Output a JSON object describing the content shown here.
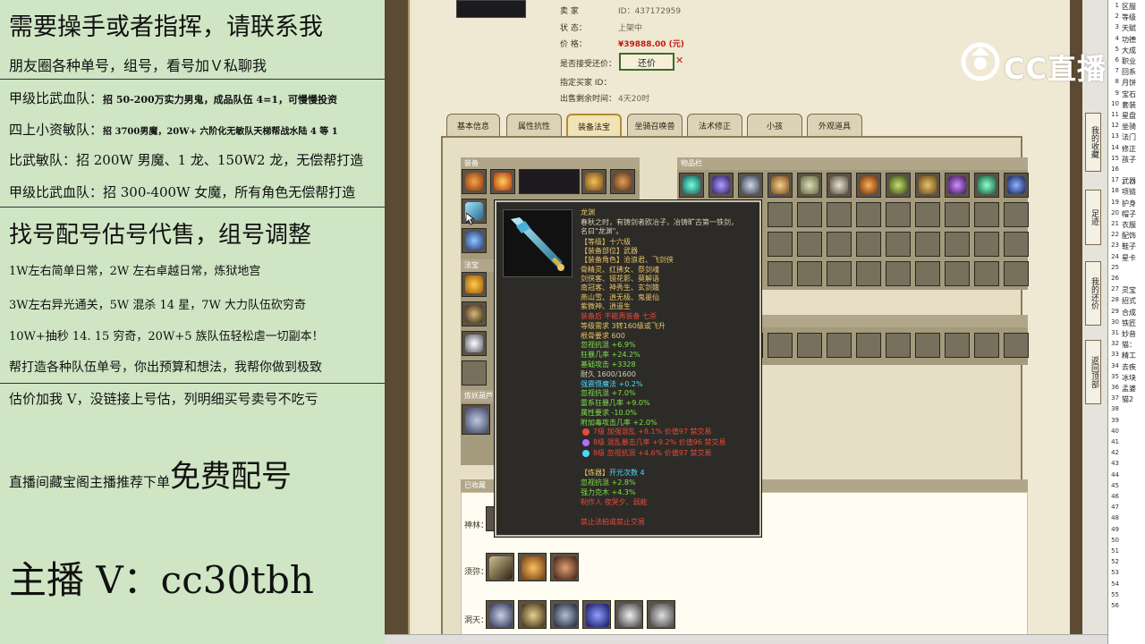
{
  "promo": {
    "title": "需要操手或者指挥，请联系我",
    "line2": "朋友圈各种单号，组号，看号加Ｖ私聊我",
    "team1_head": "甲级比武血队：",
    "team1_body": "招 50-200万实力男鬼，成品队伍 4=1，可慢慢投资",
    "team2_head": "四上小资敏队：",
    "team2_body": "招 3700男魔，20W+ 六阶化无敏队天梯帮战水陆 4 等 1",
    "team3": "比武敏队：招 200W 男魔、1 龙、150W2 龙，无偿帮打造",
    "team4": "甲级比武血队：招 300-400W 女魔，所有角色无偿帮打造",
    "heading2": "找号配号估号代售，组号调整",
    "s1": "1W左右简单日常，2W 左右卓越日常，炼狱地宫",
    "s2": "3W左右异光通关，5W 混杀 14 星，7W 大力队伍砍穷奇",
    "s3": "10W+抽秒 14. 15 穷奇，20W+5 族队伍轻松虐一切副本！",
    "s4": "帮打造各种队伍单号，你出预算和想法，我帮你做到极致",
    "s5": "估价加我 V，没链接上号估，列明细买号卖号不吃亏",
    "rec_small": "直播间藏宝阁主播推荐下单",
    "rec_big": "免费配号",
    "contact": "主播 V：cc30tbh"
  },
  "listing": {
    "seller_label": "卖  家",
    "seller_value": "ID：437172959",
    "status_label": "状     态：",
    "status_value": "上架中",
    "price_label": "价     格：",
    "price_value": "¥39888.00 (元)",
    "bargain_label": "是否接受还价：",
    "bargain_button": "还价",
    "buyer_label": "指定买家 ID：",
    "time_label": "出售剩余时间：",
    "time_value": "4天20时"
  },
  "tabs": [
    "基本信息",
    "属性抗性",
    "装备法宝",
    "坐骑召唤兽",
    "法术修正",
    "小孩",
    "外观道具"
  ],
  "sections": {
    "equip": "装备",
    "items": "物品栏",
    "fabao": "法宝",
    "pets": "炼妖葫芦",
    "collected": "已收藏",
    "shenbing": "神林：",
    "sifu": "须弥：",
    "dongtian": "洞天："
  },
  "tooltip": {
    "name": "龙渊",
    "desc1": "春秋之时，有铸剑者欧冶子，冶铸旷古第一铁剑，",
    "desc2": "名曰\"龙渊\"。",
    "grade": "【等级】十六级",
    "part": "【装备部位】武器",
    "role": "【装备角色】沧浪君、飞剑侠",
    "r1": "骨精灵、红拂女、祭剑魂",
    "r2": "剑侠客、镜花影、莫解语",
    "r3": "南冠客、神秀生、玄剑娥",
    "r4": "燕山雪、逍无极、鬼墨仙",
    "r5": "紫微神、逍遥生",
    "bind": "装备后 不能再装备 七杀",
    "req": "等级需求 3转160级或飞升",
    "gengu": "根骨要求 600",
    "a1": "忽视抗混 +6.9%",
    "a2": "狂暴几率 +24.2%",
    "a3": "基础攻击 +3328",
    "a4": "耐久 1600/1600",
    "a5": "强震慑魔法 +0.2%",
    "a6": "忽视抗混 +7.0%",
    "a7": "雷系狂暴几率 +9.0%",
    "a8": "属性要求 -10.0%",
    "a9": "附加毒攻击几率 +2.0%",
    "g1": "7级  加强混乱 +8.1% 价值97 禁交易",
    "g2": "8级  混乱暴击几率 +9.2% 价值96 禁交易",
    "g3": "8级  忽视抗混 +4.6% 价值97 禁交易",
    "refine_head": "【炼器】",
    "refine_val": "开光次数 4",
    "b1": "忽视抗混 +2.8%",
    "b2": "强力克木 +4.3%",
    "maker": "制作人 夜哭夕、弱能",
    "warn": "禁止法拍或禁止交易"
  },
  "side_tabs": [
    "我的收藏",
    "足迹",
    "我的还价",
    "返回顶部"
  ],
  "sheet_rows": [
    {
      "n": "1",
      "t": "区服"
    },
    {
      "n": "2",
      "t": "等级"
    },
    {
      "n": "3",
      "t": "天赋"
    },
    {
      "n": "4",
      "t": "功德"
    },
    {
      "n": "5",
      "t": "大成"
    },
    {
      "n": "6",
      "t": "职业"
    },
    {
      "n": "7",
      "t": "回系"
    },
    {
      "n": "8",
      "t": "月饼"
    },
    {
      "n": "9",
      "t": "宝石"
    },
    {
      "n": "10",
      "t": "套装"
    },
    {
      "n": "11",
      "t": "星盘"
    },
    {
      "n": "12",
      "t": "坐骑"
    },
    {
      "n": "13",
      "t": "法门"
    },
    {
      "n": "14",
      "t": "修正"
    },
    {
      "n": "15",
      "t": "孩子"
    },
    {
      "n": "16",
      "t": ""
    },
    {
      "n": "17",
      "t": "武器"
    },
    {
      "n": "18",
      "t": "项链"
    },
    {
      "n": "19",
      "t": "护身"
    },
    {
      "n": "20",
      "t": "帽子"
    },
    {
      "n": "21",
      "t": "衣服"
    },
    {
      "n": "22",
      "t": "配饰"
    },
    {
      "n": "23",
      "t": "鞋子"
    },
    {
      "n": "24",
      "t": "星卡"
    },
    {
      "n": "25",
      "t": ""
    },
    {
      "n": "26",
      "t": ""
    },
    {
      "n": "27",
      "t": "灵宝"
    },
    {
      "n": "28",
      "t": "招式"
    },
    {
      "n": "29",
      "t": "合成"
    },
    {
      "n": "30",
      "t": "铁匠"
    },
    {
      "n": "31",
      "t": "妙音"
    },
    {
      "n": "32",
      "t": "猫："
    },
    {
      "n": "33",
      "t": "精工"
    },
    {
      "n": "34",
      "t": "去疾"
    },
    {
      "n": "35",
      "t": "冰块"
    },
    {
      "n": "36",
      "t": "孟婆"
    },
    {
      "n": "37",
      "t": "猫2"
    },
    {
      "n": "38",
      "t": ""
    },
    {
      "n": "39",
      "t": ""
    },
    {
      "n": "40",
      "t": ""
    },
    {
      "n": "41",
      "t": ""
    },
    {
      "n": "42",
      "t": ""
    },
    {
      "n": "43",
      "t": ""
    },
    {
      "n": "44",
      "t": ""
    },
    {
      "n": "45",
      "t": ""
    },
    {
      "n": "46",
      "t": ""
    },
    {
      "n": "47",
      "t": ""
    },
    {
      "n": "48",
      "t": ""
    },
    {
      "n": "49",
      "t": ""
    },
    {
      "n": "50",
      "t": ""
    },
    {
      "n": "51",
      "t": ""
    },
    {
      "n": "52",
      "t": ""
    },
    {
      "n": "53",
      "t": ""
    },
    {
      "n": "54",
      "t": ""
    },
    {
      "n": "55",
      "t": ""
    },
    {
      "n": "56",
      "t": ""
    }
  ],
  "logo": {
    "text": "CC直播"
  },
  "colors": {
    "accent": "#c21a10",
    "panel": "#cfe5c4",
    "tooltip_bg": "#2d2b27",
    "gold": "#e8c46a",
    "green": "#7ce04a",
    "red": "#e94a3c",
    "cyan": "#4ad7ff"
  }
}
